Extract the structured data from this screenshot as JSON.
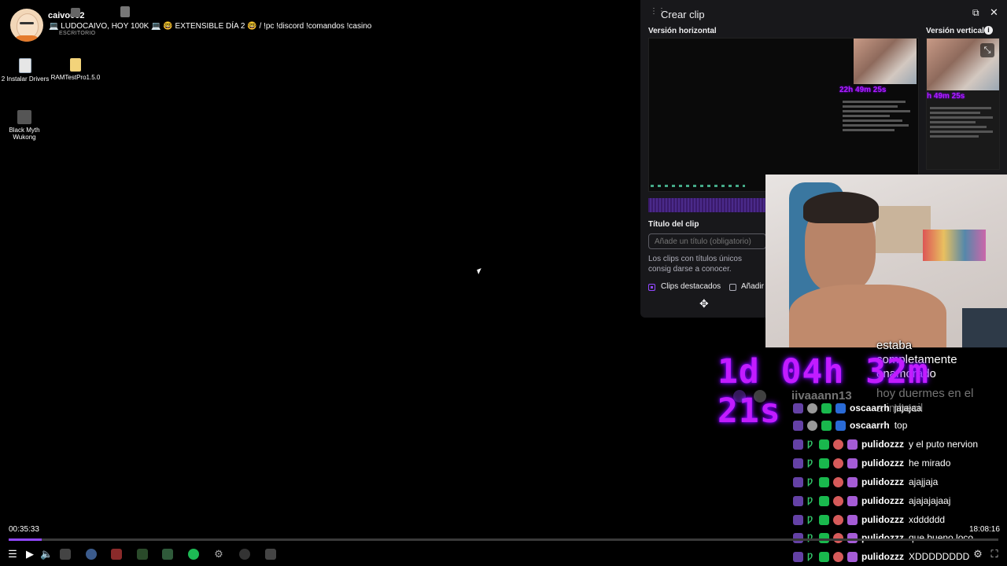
{
  "stream": {
    "channel": "caivo002",
    "title": "💻 LUDOCAIVO, HOY 100K 💻 🤓 EXTENSIBLE DÍA 2 🤓 / !pc !discord !comandos !casino",
    "desk_label": "ESCRITORIO"
  },
  "desktop_icons": [
    {
      "label": "2 Instalar Drivers"
    },
    {
      "label": "RAMTestPro1.5.0"
    },
    {
      "label": "Black Myth Wukong"
    }
  ],
  "clip_panel": {
    "title": "Crear clip",
    "horizontal_label": "Versión horizontal",
    "vertical_label": "Versión vertical",
    "mini_timer_h": "22h 49m 25s",
    "mini_timer_v": "h 49m 25s",
    "clip_title_label": "Título del clip",
    "clip_title_placeholder": "Añade un título (obligatorio)",
    "note": "Los clips con títulos únicos consig darse a conocer.",
    "featured_label": "Clips destacados",
    "add_label": "Añadir"
  },
  "overlay": {
    "timer": "1d 04h 32m 21s",
    "line1": "estaba",
    "line2": "completamente",
    "line3": "enamorado",
    "line4": "hoy duermes en el",
    "line5": "a imbecil",
    "user_faded": "iivaaann13"
  },
  "chat": [
    {
      "user": "oscaarrh",
      "msg": "jajajaa",
      "kind": "gray"
    },
    {
      "user": "oscaarrh",
      "msg": "top",
      "kind": "gray"
    },
    {
      "user": "pulidozzz",
      "msg": "y el puto nervion",
      "kind": "prime"
    },
    {
      "user": "pulidozzz",
      "msg": "he mirado",
      "kind": "prime"
    },
    {
      "user": "pulidozzz",
      "msg": "ajajjaja",
      "kind": "prime"
    },
    {
      "user": "pulidozzz",
      "msg": "ajajajajaaj",
      "kind": "prime"
    },
    {
      "user": "pulidozzz",
      "msg": "xdddddd",
      "kind": "prime"
    },
    {
      "user": "pulidozzz",
      "msg": "que bueno loco",
      "kind": "prime"
    },
    {
      "user": "pulidozzz",
      "msg": "XDDDDDDDD",
      "kind": "prime"
    }
  ],
  "player": {
    "current_time": "00:35:33",
    "clock": "18:08:16",
    "progress": 0.033
  },
  "colors": {
    "accent": "#9147ff",
    "timer": "#c21cff",
    "panel_bg": "#18181b"
  }
}
